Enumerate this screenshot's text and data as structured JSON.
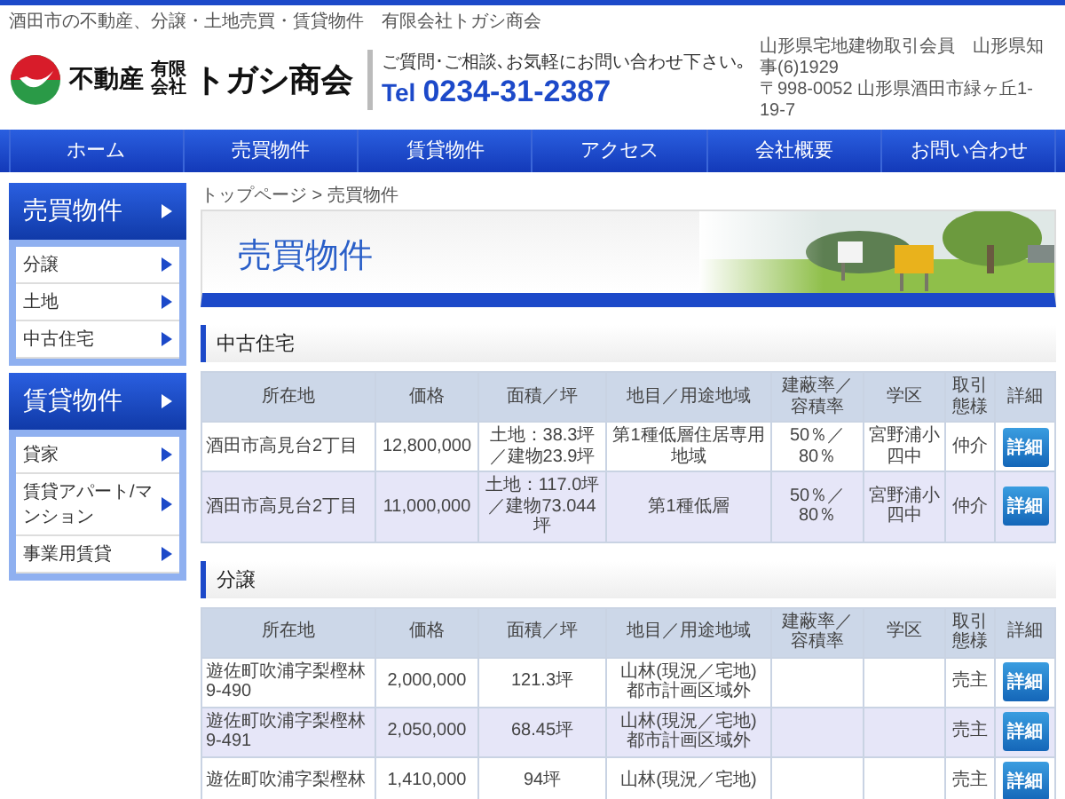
{
  "header": {
    "tagline": "酒田市の不動産、分譲・土地売買・賃貸物件　有限会社トガシ商会",
    "logo": {
      "main": "不動産",
      "corp_top": "有限",
      "corp_bottom": "会社",
      "name": "トガシ商会"
    },
    "contact": {
      "prompt": "ご質問･ご相談､お気軽にお問い合わせ下さい｡",
      "tel_label": "Tel",
      "tel": "0234-31-2387"
    },
    "company_info": [
      "山形県宅地建物取引会員　山形県知事(6)1929",
      "〒998-0052 山形県酒田市緑ヶ丘1-19-7"
    ]
  },
  "nav": [
    "ホーム",
    "売買物件",
    "賃貸物件",
    "アクセス",
    "会社概要",
    "お問い合わせ"
  ],
  "sidebar": [
    {
      "title": "売買物件",
      "items": [
        "分譲",
        "土地",
        "中古住宅"
      ]
    },
    {
      "title": "賃貸物件",
      "items": [
        "貸家",
        "賃貸アパート/マンション",
        "事業用賃貸"
      ]
    }
  ],
  "breadcrumb": "トップページ > 売買物件",
  "banner": {
    "title": "売買物件",
    "kind": "picture"
  },
  "sections": [
    {
      "title": "中古住宅",
      "columns": [
        "所在地",
        "価格",
        "面積／坪",
        "地目／用途地域",
        "建蔽率／容積率",
        "学区",
        "取引態様",
        "詳細"
      ],
      "rows": [
        {
          "cells": [
            "酒田市高見台2丁目",
            "12,800,000",
            "土地：38.3坪／建物23.9坪",
            "第1種低層住居専用地域",
            "50％／\n80％",
            "宮野浦小四中",
            "仲介"
          ],
          "button": "詳細"
        },
        {
          "cells": [
            "酒田市高見台2丁目",
            "11,000,000",
            "土地：117.0坪／建物73.044坪",
            "第1種低層",
            "50％／\n80％",
            "宮野浦小四中",
            "仲介"
          ],
          "button": "詳細"
        }
      ]
    },
    {
      "title": "分譲",
      "columns": [
        "所在地",
        "価格",
        "面積／坪",
        "地目／用途地域",
        "建蔽率／容積率",
        "学区",
        "取引態様",
        "詳細"
      ],
      "rows": [
        {
          "cells": [
            "遊佐町吹浦字梨樫林\n9-490",
            "2,000,000",
            "121.3坪",
            "山林(現況／宅地)\n都市計画区域外",
            null,
            null,
            "売主"
          ],
          "button": "詳細"
        },
        {
          "cells": [
            "遊佐町吹浦字梨樫林\n9-491",
            "2,050,000",
            "68.45坪",
            "山林(現況／宅地)\n都市計画区域外",
            null,
            null,
            "売主"
          ],
          "button": "詳細"
        },
        {
          "cells": [
            "遊佐町吹浦字梨樫林",
            "1,410,000",
            "94坪",
            "山林(現況／宅地)",
            null,
            null,
            "売主"
          ],
          "button": "詳細"
        }
      ]
    }
  ]
}
